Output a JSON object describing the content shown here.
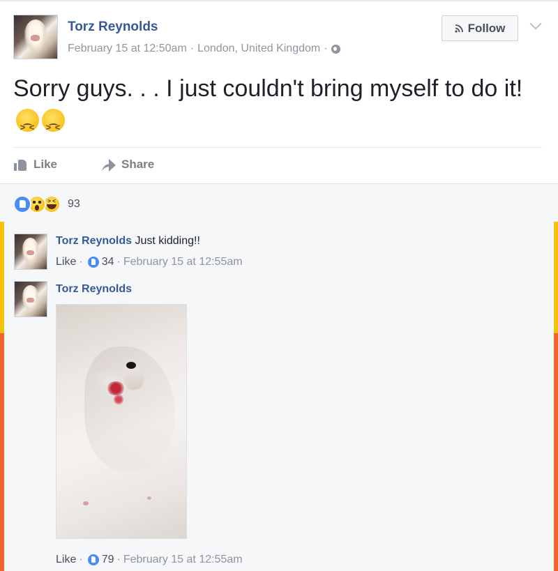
{
  "post": {
    "author": "Torz Reynolds",
    "date": "February 15 at 12:50am",
    "location": "London, United Kingdom",
    "separator": "·",
    "privacy_icon": "globe-icon",
    "text": "Sorry guys. . . I just couldn't bring myself to do it!",
    "emojis": [
      "persevering-face",
      "persevering-face"
    ]
  },
  "header": {
    "follow_label": "Follow",
    "follow_icon": "rss-icon"
  },
  "actions": {
    "like_label": "Like",
    "share_label": "Share"
  },
  "reactions": {
    "types": [
      "like",
      "wow",
      "haha"
    ],
    "count": "93"
  },
  "comments": [
    {
      "author": "Torz Reynolds",
      "text": "Just kidding!!",
      "like_label": "Like",
      "like_count": "34",
      "time": "February 15 at 12:55am"
    },
    {
      "author": "Torz Reynolds",
      "text": "",
      "has_photo": true,
      "like_label": "Like",
      "like_count": "79",
      "time": "February 15 at 12:55am"
    }
  ],
  "colors": {
    "link_blue": "#365899",
    "like_blue": "#4a8cf7",
    "side_bar_yellow": "#f4c20d",
    "side_bar_orange": "#f2622a",
    "muted_text": "#90949c"
  }
}
